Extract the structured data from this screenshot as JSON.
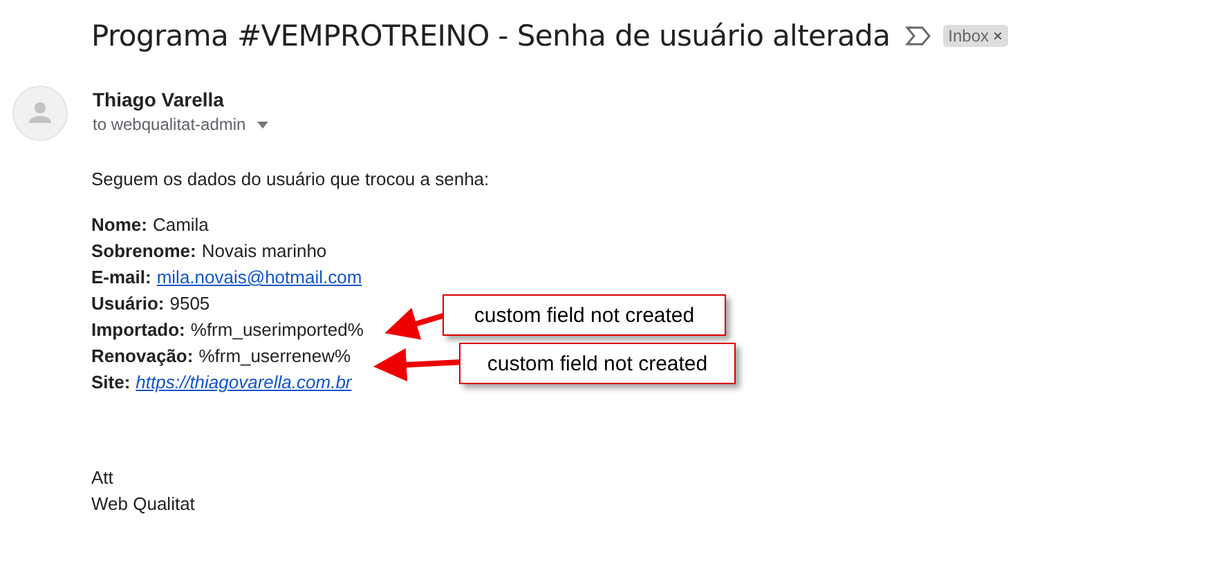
{
  "subject": "Programa #VEMPROTREINO - Senha de usuário alterada",
  "label": {
    "text": "Inbox",
    "close": "×"
  },
  "sender": {
    "name": "Thiago Varella",
    "to": "to webqualitat-admin"
  },
  "intro": "Seguem os dados do usuário que trocou a senha:",
  "fields": [
    {
      "label": "Nome:",
      "value": "Camila",
      "kind": "text"
    },
    {
      "label": "Sobrenome:",
      "value": "Novais marinho",
      "kind": "text"
    },
    {
      "label": "E-mail:",
      "value": "mila.novais@hotmail.com",
      "kind": "email"
    },
    {
      "label": "Usuário:",
      "value": "9505",
      "kind": "text"
    },
    {
      "label": "Importado:",
      "value": "%frm_userimported%",
      "kind": "text"
    },
    {
      "label": "Renovação:",
      "value": "%frm_userrenew%",
      "kind": "text"
    },
    {
      "label": "Site:",
      "value": "https://thiagovarella.com.br",
      "kind": "url"
    }
  ],
  "signature": [
    "Att",
    "Web Qualitat"
  ],
  "callouts": [
    {
      "text": "custom field not created"
    },
    {
      "text": "custom field not created"
    }
  ]
}
